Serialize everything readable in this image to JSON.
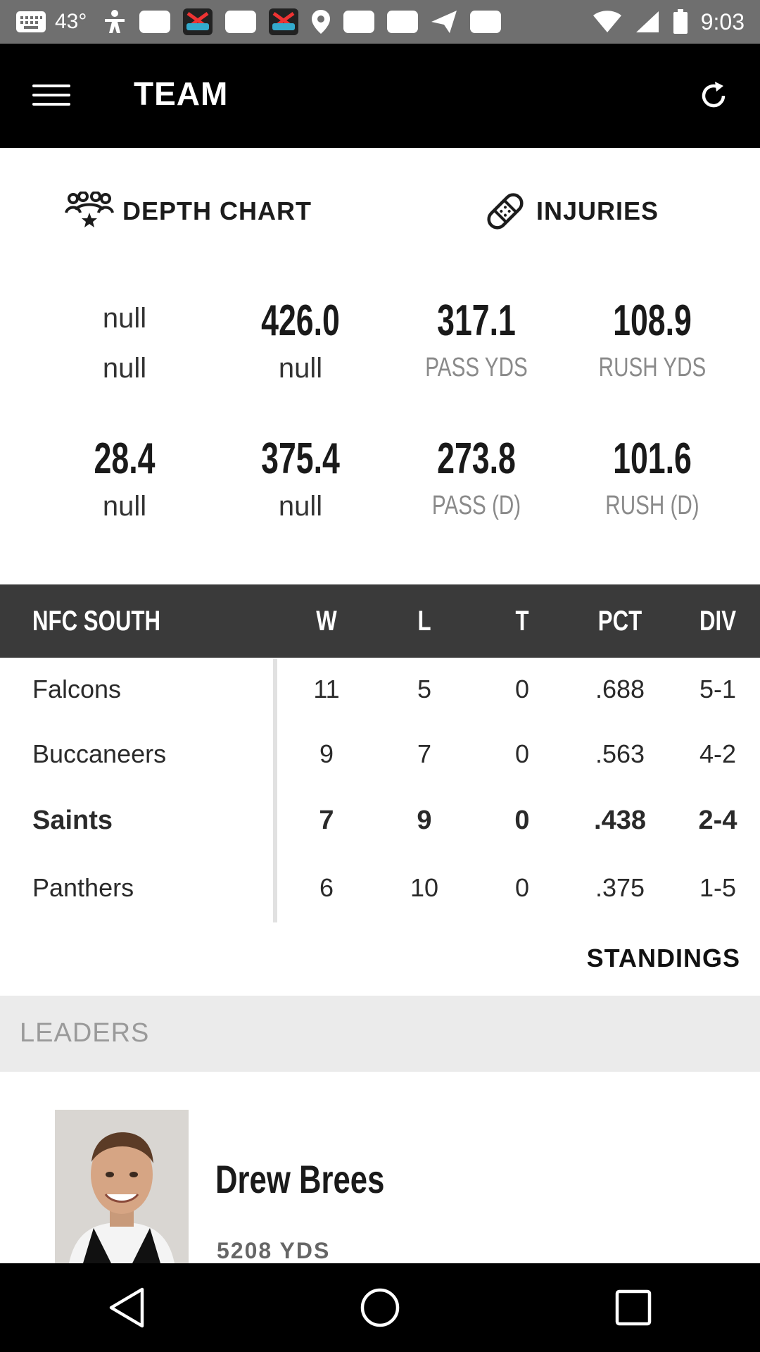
{
  "status_bar": {
    "temperature": "43°",
    "time": "9:03",
    "colors": {
      "background": "#6f6f6f"
    }
  },
  "app_bar": {
    "title": "TEAM",
    "icons": {
      "menu": "menu-icon",
      "refresh": "refresh-icon"
    }
  },
  "tabs": [
    {
      "label": "DEPTH CHART",
      "icon": "group-icon"
    },
    {
      "label": "INJURIES",
      "icon": "bandage-icon"
    }
  ],
  "stats": {
    "row1": [
      {
        "value": "null",
        "label": "null"
      },
      {
        "value": "426.0",
        "label": "null"
      },
      {
        "value": "317.1",
        "label": "PASS YDS"
      },
      {
        "value": "108.9",
        "label": "RUSH YDS"
      }
    ],
    "row2": [
      {
        "value": "28.4",
        "label": "null"
      },
      {
        "value": "375.4",
        "label": "null"
      },
      {
        "value": "273.8",
        "label": "PASS (D)"
      },
      {
        "value": "101.6",
        "label": "RUSH (D)"
      }
    ]
  },
  "standings": {
    "division": "NFC SOUTH",
    "columns": [
      "W",
      "L",
      "T",
      "PCT",
      "DIV"
    ],
    "rows": [
      {
        "team": "Falcons",
        "w": "11",
        "l": "5",
        "t": "0",
        "pct": ".688",
        "div": "5-1"
      },
      {
        "team": "Buccaneers",
        "w": "9",
        "l": "7",
        "t": "0",
        "pct": ".563",
        "div": "4-2"
      },
      {
        "team": "Saints",
        "w": "7",
        "l": "9",
        "t": "0",
        "pct": ".438",
        "div": "2-4"
      },
      {
        "team": "Panthers",
        "w": "6",
        "l": "10",
        "t": "0",
        "pct": ".375",
        "div": "1-5"
      }
    ],
    "link_label": "STANDINGS",
    "colors": {
      "header_bg": "#3a3a3a"
    }
  },
  "leaders": {
    "title": "LEADERS",
    "player": {
      "name": "Drew Brees",
      "stat": "5208 YDS"
    }
  }
}
